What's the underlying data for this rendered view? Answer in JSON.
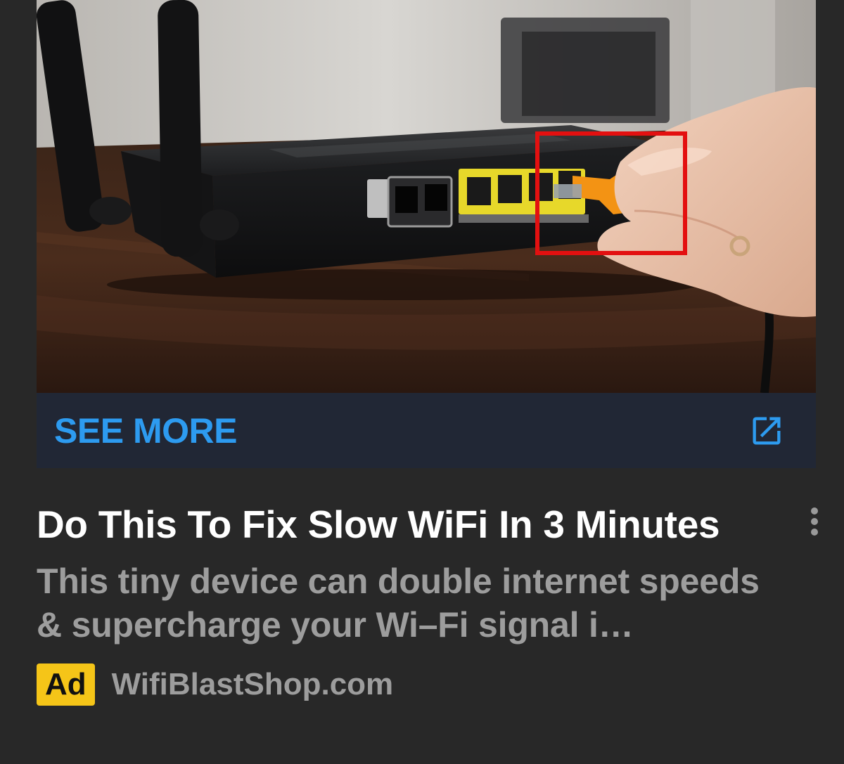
{
  "ad_card": {
    "cta": {
      "label": "SEE MORE",
      "icon": "open-in-new-icon",
      "color": "#2d9bf0"
    },
    "headline": "Do This To Fix Slow WiFi In 3 Minutes",
    "menu_icon": "more-vert-icon",
    "description": "This tiny device can double internet speeds & supercharge your Wi–Fi signal i…",
    "badge": {
      "label": "Ad",
      "color": "#f5c518"
    },
    "source": "WifiBlastShop.com"
  },
  "image": {
    "subject": "router-ethernet-cable-photo",
    "highlight_color": "#e31010"
  }
}
